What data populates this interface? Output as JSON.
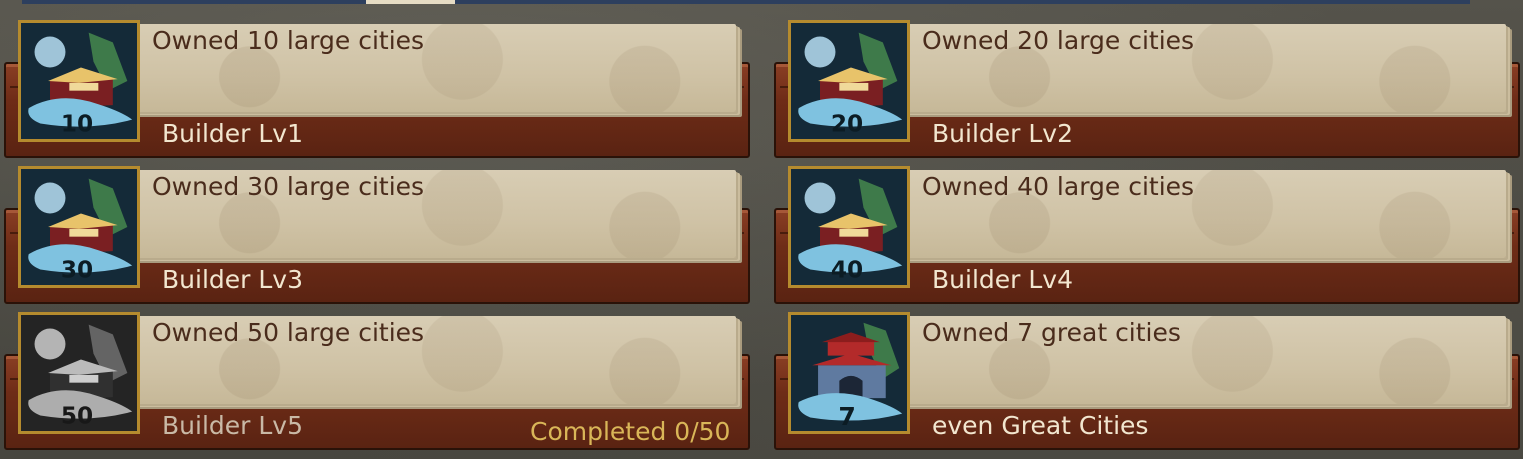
{
  "achievements": [
    {
      "title": "Owned 10 large cities",
      "reward": "Builder Lv1",
      "badge": "10",
      "icon": "palace-cloud-icon",
      "state": "completed"
    },
    {
      "title": "Owned 20 large cities",
      "reward": "Builder Lv2",
      "badge": "20",
      "icon": "palace-cloud-icon",
      "state": "completed"
    },
    {
      "title": "Owned 30 large cities",
      "reward": "Builder Lv3",
      "badge": "30",
      "icon": "palace-cloud-icon",
      "state": "completed"
    },
    {
      "title": "Owned 40 large cities",
      "reward": "Builder Lv4",
      "badge": "40",
      "icon": "palace-cloud-icon",
      "state": "completed"
    },
    {
      "title": "Owned 50 large cities",
      "reward": "Builder Lv5",
      "badge": "50",
      "icon": "palace-cloud-icon",
      "state": "locked",
      "progress": "Completed 0/50"
    },
    {
      "title": "Owned 7 great cities",
      "reward": "even Great Cities",
      "badge": "7",
      "icon": "city-gate-icon",
      "state": "completed"
    }
  ],
  "colors": {
    "title_text": "#4a2c1c",
    "reward_text": "#f2e6cf",
    "progress_text": "#d9b658",
    "tray": "#6e2c17",
    "paper": "#d8cdb4",
    "frame": "#b58b2e"
  }
}
